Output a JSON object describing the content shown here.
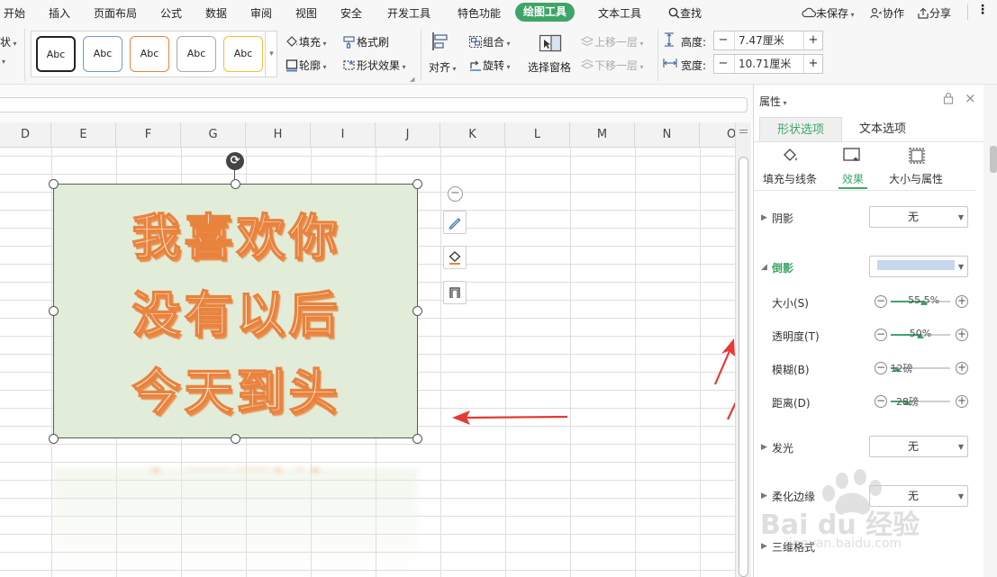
{
  "menu": {
    "tabs": [
      "开始",
      "插入",
      "页面布局",
      "公式",
      "数据",
      "审阅",
      "视图",
      "安全",
      "开发工具",
      "特色功能",
      "绘图工具",
      "文本工具"
    ],
    "active_tab": "绘图工具",
    "search": "查找",
    "unsaved": "未保存",
    "collab": "协作",
    "share": "分享"
  },
  "ribbon": {
    "left_cut": "状",
    "style_samples": [
      "Abc",
      "Abc",
      "Abc",
      "Abc",
      "Abc"
    ],
    "fill": "填充",
    "format_brush": "格式刷",
    "outline": "轮廓",
    "shape_effect": "形状效果",
    "align": "对齐",
    "group": "组合",
    "rotate": "旋转",
    "select_pane": "选择窗格",
    "bring_forward": "上移一层",
    "send_backward": "下移一层",
    "height_label": "高度:",
    "height_value": "7.47厘米",
    "width_label": "宽度:",
    "width_value": "10.71厘米"
  },
  "sheet": {
    "columns": [
      "D",
      "E",
      "F",
      "G",
      "H",
      "I",
      "J",
      "K",
      "L",
      "M",
      "N",
      "O"
    ]
  },
  "shape": {
    "lines": [
      "我喜欢你",
      "没有以后",
      "今天到头"
    ]
  },
  "panel": {
    "title": "属性",
    "tabs": [
      "形状选项",
      "文本选项"
    ],
    "active_tab": "形状选项",
    "subtabs": [
      "填充与线条",
      "效果",
      "大小与属性"
    ],
    "active_subtab": "效果",
    "shadow": {
      "label": "阴影",
      "value": "无"
    },
    "reflection": {
      "label": "倒影",
      "color": "#c9d7ec",
      "size": {
        "label": "大小(S)",
        "value": "55.5%",
        "fraction": 0.555
      },
      "transparency": {
        "label": "透明度(T)",
        "value": "50%",
        "fraction": 0.5
      },
      "blur": {
        "label": "模糊(B)",
        "value": "12磅",
        "fraction": 0.1
      },
      "distance": {
        "label": "距离(D)",
        "value": "28磅",
        "fraction": 0.28
      }
    },
    "glow": {
      "label": "发光",
      "value": "无"
    },
    "soft_edge": {
      "label": "柔化边缘",
      "value": "无"
    },
    "three_d": {
      "label": "三维格式"
    }
  },
  "watermark": {
    "text": "Bai du 经验",
    "url": "jingyan.baidu.com"
  },
  "colors": {
    "accent": "#3fa567",
    "text_stroke": "#e8833e",
    "shape_fill": "#e2edd9",
    "arrow": "#e53935"
  },
  "icons": {
    "search": "search-icon",
    "cloud": "cloud-icon",
    "share": "share-icon",
    "more": "more-vert-icon",
    "lock": "lock-icon",
    "close": "close-icon"
  }
}
